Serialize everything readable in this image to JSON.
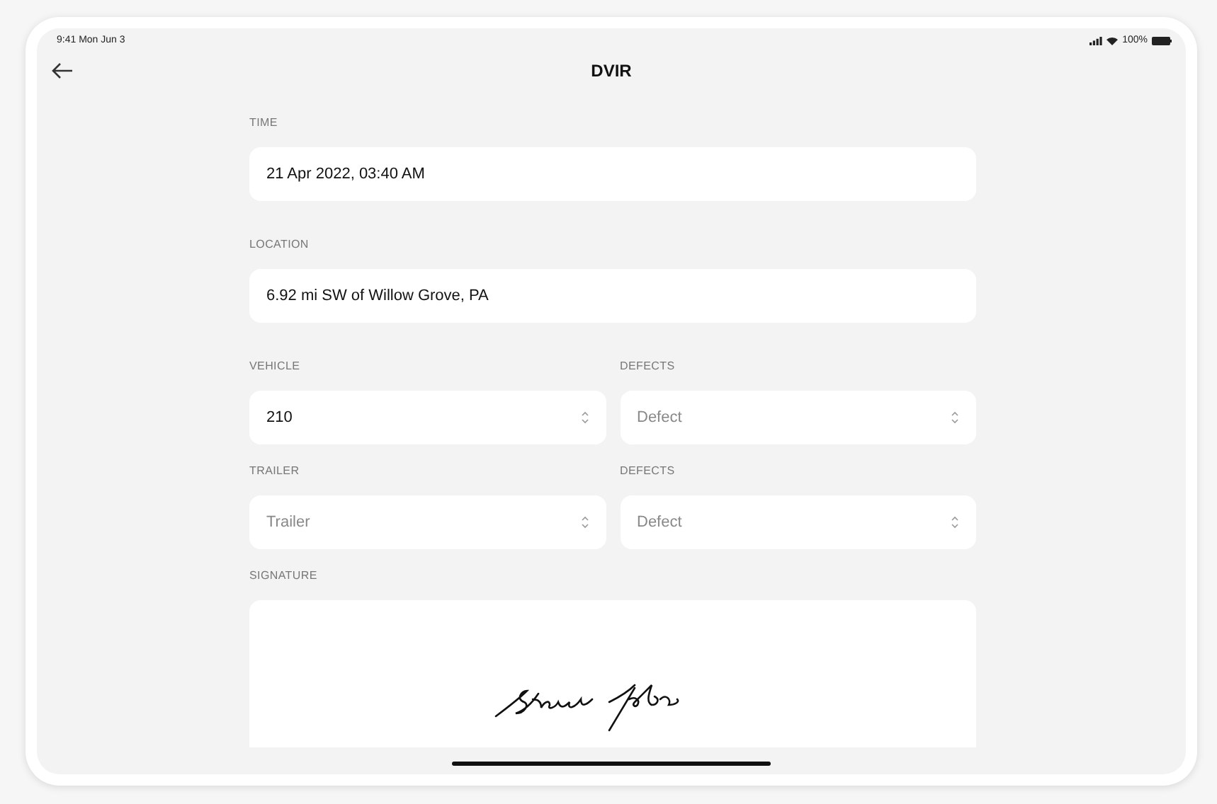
{
  "status_bar": {
    "time": "9:41 Mon Jun 3",
    "battery": "100%"
  },
  "nav": {
    "title": "DVIR"
  },
  "fields": [
    {
      "label": "TIME",
      "value": "21 Apr 2022, 03:40 AM"
    },
    {
      "label": "LOCATION",
      "value": "6.92 mi SW of Willow Grove, PA"
    }
  ],
  "select_rows": [
    [
      {
        "label": "VEHICLE",
        "value": "210"
      },
      {
        "label": "DEFECTS",
        "placeholder": "Defect"
      }
    ],
    [
      {
        "label": "TRAILER",
        "placeholder": "Trailer"
      },
      {
        "label": "DEFECTS",
        "placeholder": "Defect"
      }
    ]
  ],
  "signature": {
    "label": "SIGNATURE"
  }
}
